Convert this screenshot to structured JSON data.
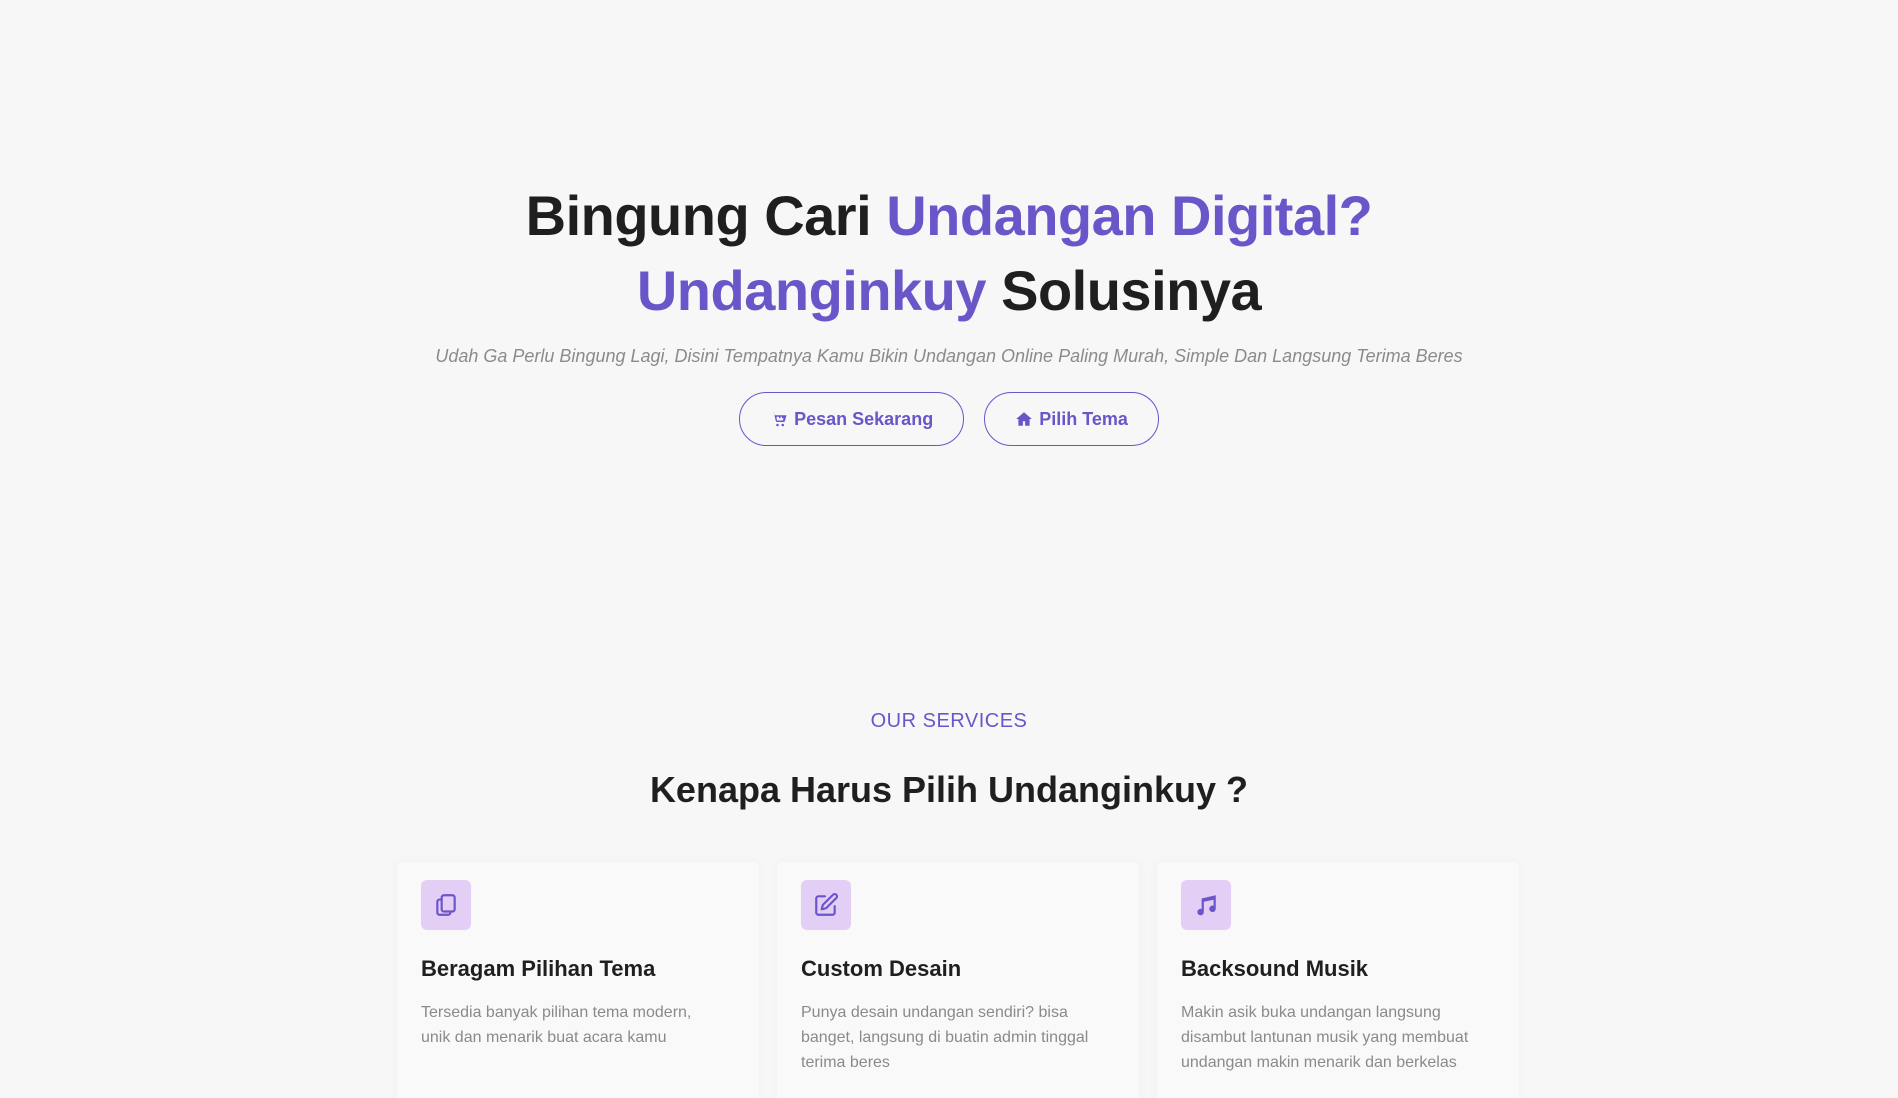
{
  "hero": {
    "title_line1_part1": "Bingung Cari ",
    "title_line1_part2": "Undangan Digital?",
    "title_line2_part1": "Undanginkuy",
    "title_line2_part2": " Solusinya",
    "subtitle": "Udah Ga Perlu Bingung Lagi, Disini Tempatnya Kamu Bikin Undangan Online Paling Murah, Simple Dan Langsung Terima Beres",
    "buttons": {
      "order": {
        "label": "Pesan Sekarang",
        "icon": "cart-icon"
      },
      "theme": {
        "label": "Pilih Tema",
        "icon": "home-icon"
      }
    }
  },
  "services": {
    "eyebrow": "OUR SERVICES",
    "title": "Kenapa Harus Pilih Undanginkuy ?",
    "cards": [
      {
        "icon": "copy-icon",
        "title": "Beragam Pilihan Tema",
        "desc": "Tersedia banyak pilihan tema modern, unik dan menarik buat acara kamu"
      },
      {
        "icon": "edit-icon",
        "title": "Custom Desain",
        "desc": "Punya desain undangan sendiri? bisa banget, langsung di buatin admin tinggal terima beres"
      },
      {
        "icon": "music-icon",
        "title": "Backsound Musik",
        "desc": "Makin asik buka undangan langsung disambut lantunan musik yang membuat undangan makin menarik dan berkelas"
      }
    ]
  },
  "colors": {
    "accent": "#6a55c9",
    "icon_bg": "#e3cff6",
    "background": "#f7f7f8"
  }
}
